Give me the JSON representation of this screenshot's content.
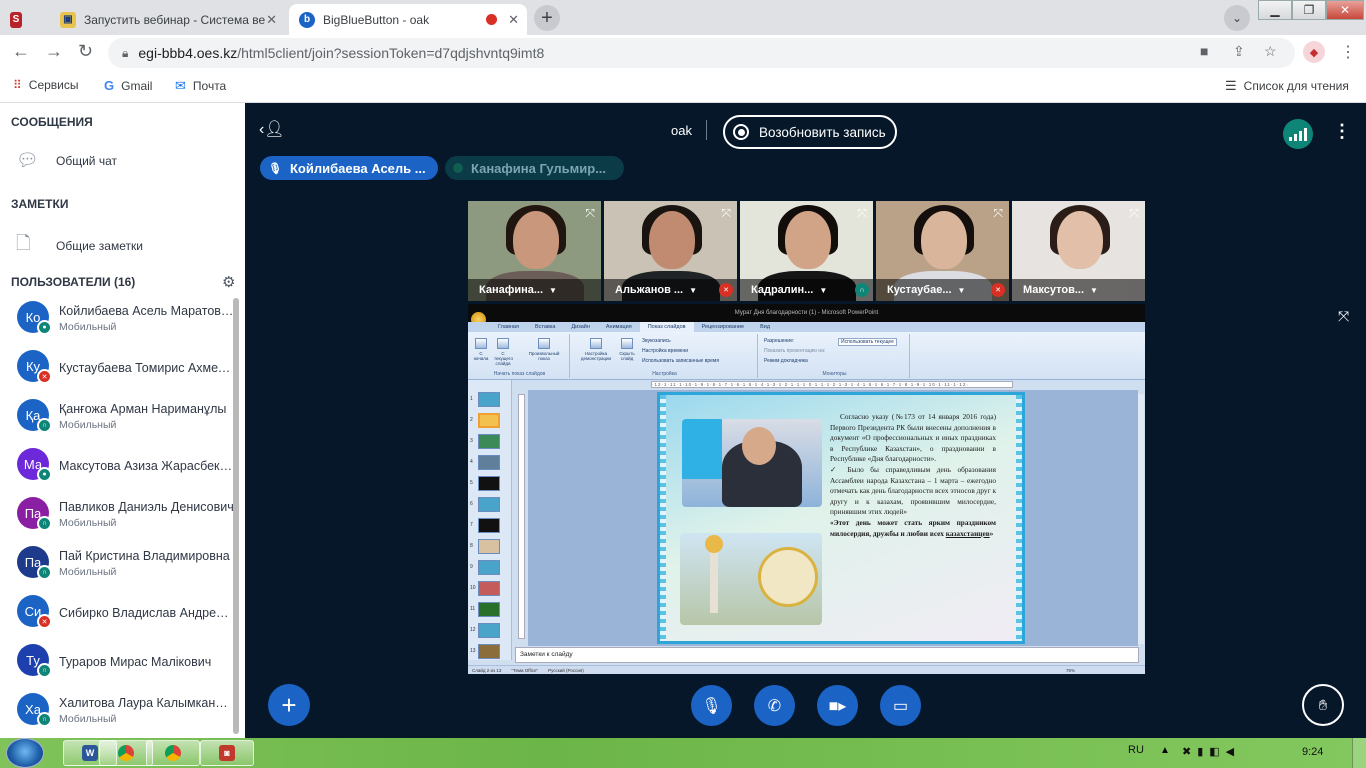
{
  "browser": {
    "tabs": [
      {
        "title": "Запустить вебинар - Система ве",
        "favicon": "courses-icon"
      },
      {
        "title": "BigBlueButton - oak",
        "favicon": "bbb-icon"
      }
    ],
    "new_tab": "+",
    "url_host": "egi-bbb4.oes.kz",
    "url_path": "/html5client/join?sessionToken=d7qdjshvntq9imt8",
    "bookmarks": [
      "Сервисы",
      "Gmail",
      "Почта"
    ],
    "reading_list": "Список для чтения"
  },
  "sidebar": {
    "messages_title": "СООБЩЕНИЯ",
    "public_chat": "Общий чат",
    "notes_title": "ЗАМЕТКИ",
    "shared_notes": "Общие заметки",
    "users_title": "ПОЛЬЗОВАТЕЛИ (16)",
    "users": [
      {
        "initials": "Ко",
        "name": "Койлибаева Асель Маратовна",
        "role": "Мобильный",
        "avatar_color": "#1b64c6",
        "status": "mic"
      },
      {
        "initials": "Ку",
        "name": "Кустаубаева Томирис Ахметовна",
        "role": "",
        "avatar_color": "#1b64c6",
        "status": "muted"
      },
      {
        "initials": "Қа",
        "name": "Қанғожа Арман Нариманұлы",
        "role": "Мобильный",
        "avatar_color": "#1b64c6",
        "status": "listen"
      },
      {
        "initials": "Ма",
        "name": "Максутова Азиза Жарасбековна",
        "role": "",
        "avatar_color": "#6d28d9",
        "status": "mic"
      },
      {
        "initials": "Па",
        "name": "Павликов Даниэль Денисович",
        "role": "Мобильный",
        "avatar_color": "#8b1fa3",
        "status": "listen"
      },
      {
        "initials": "Па",
        "name": "Пай Кристина Владимировна",
        "role": "Мобильный",
        "avatar_color": "#1e3a8a",
        "status": "listen"
      },
      {
        "initials": "Си",
        "name": "Сибирко Владислав Андреевич",
        "role": "",
        "avatar_color": "#1b64c6",
        "status": "muted"
      },
      {
        "initials": "Ту",
        "name": "Тураров Мирас Малікович",
        "role": "",
        "avatar_color": "#1e40af",
        "status": "listen"
      },
      {
        "initials": "Ха",
        "name": "Халитова Лаура Калымкановна",
        "role": "Мобильный",
        "avatar_color": "#1b64c6",
        "status": "listen"
      }
    ]
  },
  "main": {
    "meeting_name": "oak",
    "record_label": "Возобновить запись",
    "talkers": [
      "Койлибаева Асель ...",
      "Канафина Гульмир..."
    ],
    "videos": [
      {
        "label": "Канафина...",
        "skin": "#c9987c",
        "hair": "#20150f",
        "shirt": "#6b5e58",
        "bg": "#8e9a80",
        "icon": ""
      },
      {
        "label": "Альжанов ...",
        "skin": "#c08b70",
        "hair": "#1a1410",
        "shirt": "#1f2326",
        "bg": "#c9c2b5",
        "icon": "muted"
      },
      {
        "label": "Кадралин...",
        "skin": "#d1a488",
        "hair": "#120d0b",
        "shirt": "#151515",
        "bg": "#e3e4da",
        "icon": "listen"
      },
      {
        "label": "Кустаубае...",
        "skin": "#d9b59c",
        "hair": "#140f0d",
        "shirt": "#dcdde2",
        "bg": "#b9a287",
        "icon": "muted"
      },
      {
        "label": "Максутов...",
        "skin": "#e2bfa8",
        "hair": "#2a1d18",
        "shirt": "#e9e4e1",
        "bg": "#e7e3e0",
        "icon": ""
      }
    ]
  },
  "presentation": {
    "window_title": "Мурат Дня благодарности (1) - Microsoft PowerPoint",
    "ribbon_tabs": [
      "Главная",
      "Вставка",
      "Дизайн",
      "Анимация",
      "Показ слайдов",
      "Рецензирование",
      "Вид"
    ],
    "active_tab": "Показ слайдов",
    "groups": [
      "Начать показ слайдов",
      "Настройка",
      "Мониторы"
    ],
    "buttons": [
      "С начала",
      "С текущего слайда",
      "Произвольный показ",
      "Настройка демонстрации",
      "Скрыть слайд"
    ],
    "options": [
      "Звукозапись",
      "Настройка времени",
      "Использовать записанные время",
      "Разрешение:",
      "Использовать текущее",
      "Показать презентацию на:",
      "Режим докладчика"
    ],
    "slide_text": [
      "Согласно указу (№173 от 14 января 2016 года) Первого Президента РК были внесены дополнения в документ «О профессиональных и иных праздниках в Республике Казахстан», о праздновании в Республике «Дня благодарности».",
      "✓ Было бы справедливым день образования Ассамблеи народа Казахстана – 1 марта – ежегодно отмечать как день благодарности всех этносов друг к другу и к казахам, проявившим милосердие, принявшим этих людей»"
    ],
    "slide_bold": "«Этот день может стать ярким праздником милосердия, дружбы и любви всех ",
    "slide_underline": "казахстанцев",
    "slide_end": "»",
    "notes": "Заметки к слайду",
    "status": [
      "Слайд 2 из 13",
      "\"Тема Office\"",
      "Русский (Россия)",
      "76%"
    ]
  },
  "taskbar": {
    "lang": "RU",
    "time": "9:24"
  }
}
